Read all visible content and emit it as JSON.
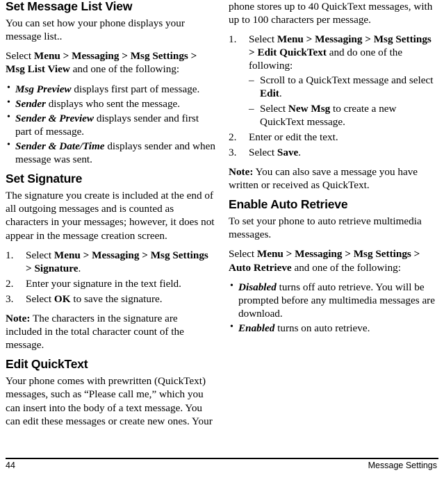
{
  "page": {
    "number": "44",
    "footer_right": "Message Settings"
  },
  "left_column": {
    "sections": [
      {
        "heading": "Set Message List View",
        "paragraph": "You can set how your phone displays your message list..",
        "select_line": {
          "lead": "Select ",
          "path": "Menu > Messaging > Msg Settings > Msg List View",
          "tail": " and one of the following:"
        },
        "bullets": [
          {
            "term": "Msg Preview",
            "text": " displays first part of message."
          },
          {
            "term": "Sender",
            "text": " displays who sent the message."
          },
          {
            "term": "Sender & Preview",
            "text": " displays sender and first part of message."
          },
          {
            "term": "Sender & Date/Time",
            "text": " displays sender and when message was sent."
          }
        ]
      },
      {
        "heading": "Set Signature",
        "paragraph": "The signature you create is included at the end of all outgoing messages and is counted as characters in your messages; however, it does not appear in the message creation screen.",
        "steps": [
          {
            "num": "1.",
            "lead": "Select ",
            "bold": "Menu > Messaging > Msg Settings > Signature",
            "tail": "."
          },
          {
            "num": "2.",
            "lead": "Enter your signature in the text field.",
            "bold": "",
            "tail": ""
          },
          {
            "num": "3.",
            "lead": "Select ",
            "bold": "OK",
            "tail": " to save the signature."
          }
        ],
        "note": {
          "label": "Note:",
          "text": " The characters in the signature are included in the total character count of the message."
        }
      },
      {
        "heading": "Edit QuickText",
        "paragraph": "Your phone comes with prewritten (QuickText) messages, such as “Please call me,” which you can insert into the body of a text message. You can edit these messages or create new ones. Your"
      }
    ]
  },
  "right_column": {
    "continuation": "phone stores up to 40 QuickText messages, with up to 100 characters per message.",
    "quicktext_steps": [
      {
        "num": "1.",
        "lead": "Select ",
        "bold": "Menu > Messaging > Msg Settings > Edit QuickText",
        "tail": " and do one of the following:",
        "sub": [
          {
            "lead": "Scroll to a QuickText message and select ",
            "bold": "Edit",
            "tail": "."
          },
          {
            "lead": "Select ",
            "bold": "New Msg",
            "tail": " to create a new QuickText message."
          }
        ]
      },
      {
        "num": "2.",
        "lead": "Enter or edit the text.",
        "bold": "",
        "tail": "",
        "sub": []
      },
      {
        "num": "3.",
        "lead": "Select ",
        "bold": "Save",
        "tail": ".",
        "sub": []
      }
    ],
    "note": {
      "label": "Note:",
      "text": " You can also save a message you have written or received as QuickText."
    },
    "sections": [
      {
        "heading": "Enable Auto Retrieve",
        "paragraph": "To set your phone to auto retrieve multimedia messages.",
        "select_line": {
          "lead": "Select ",
          "path": "Menu > Messaging > Msg Settings > Auto Retrieve",
          "tail": " and one of the following:"
        },
        "bullets": [
          {
            "term": "Disabled",
            "text": " turns off auto retrieve. You will be prompted before any multimedia messages are download."
          },
          {
            "term": "Enabled",
            "text": " turns on auto retrieve."
          }
        ]
      }
    ]
  }
}
